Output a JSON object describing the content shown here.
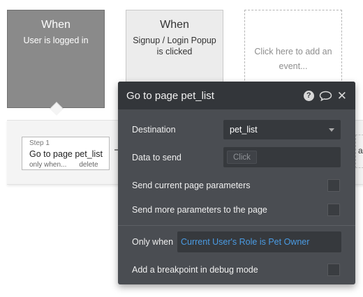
{
  "events": [
    {
      "title": "When",
      "subtitle": "User is logged in"
    },
    {
      "title": "When",
      "subtitle": "Signup / Login Popup is clicked"
    }
  ],
  "add_event": {
    "label": "Click here to add an event..."
  },
  "step": {
    "number_label": "Step 1",
    "action": "Go to page pet_list",
    "only_when_link": "only when...",
    "delete_link": "delete"
  },
  "next_step_partial": "a",
  "popup": {
    "title": "Go to page pet_list",
    "destination_label": "Destination",
    "destination_value": "pet_list",
    "data_to_send_label": "Data to send",
    "data_to_send_placeholder": "Click",
    "send_current_params_label": "Send current page parameters",
    "send_current_params_checked": false,
    "send_more_params_label": "Send more parameters to the page",
    "send_more_params_checked": false,
    "only_when_label": "Only when",
    "only_when_value": "Current User's Role is Pet Owner",
    "breakpoint_label": "Add a breakpoint in debug mode",
    "breakpoint_checked": false
  },
  "colors": {
    "popup_bg": "#4a4d52",
    "popup_header": "#33363a",
    "condition_text": "#4a9be3",
    "active_event": "#8a8a8a"
  },
  "icons": [
    "help-icon",
    "comment-icon",
    "close-icon",
    "caret-down-icon"
  ]
}
